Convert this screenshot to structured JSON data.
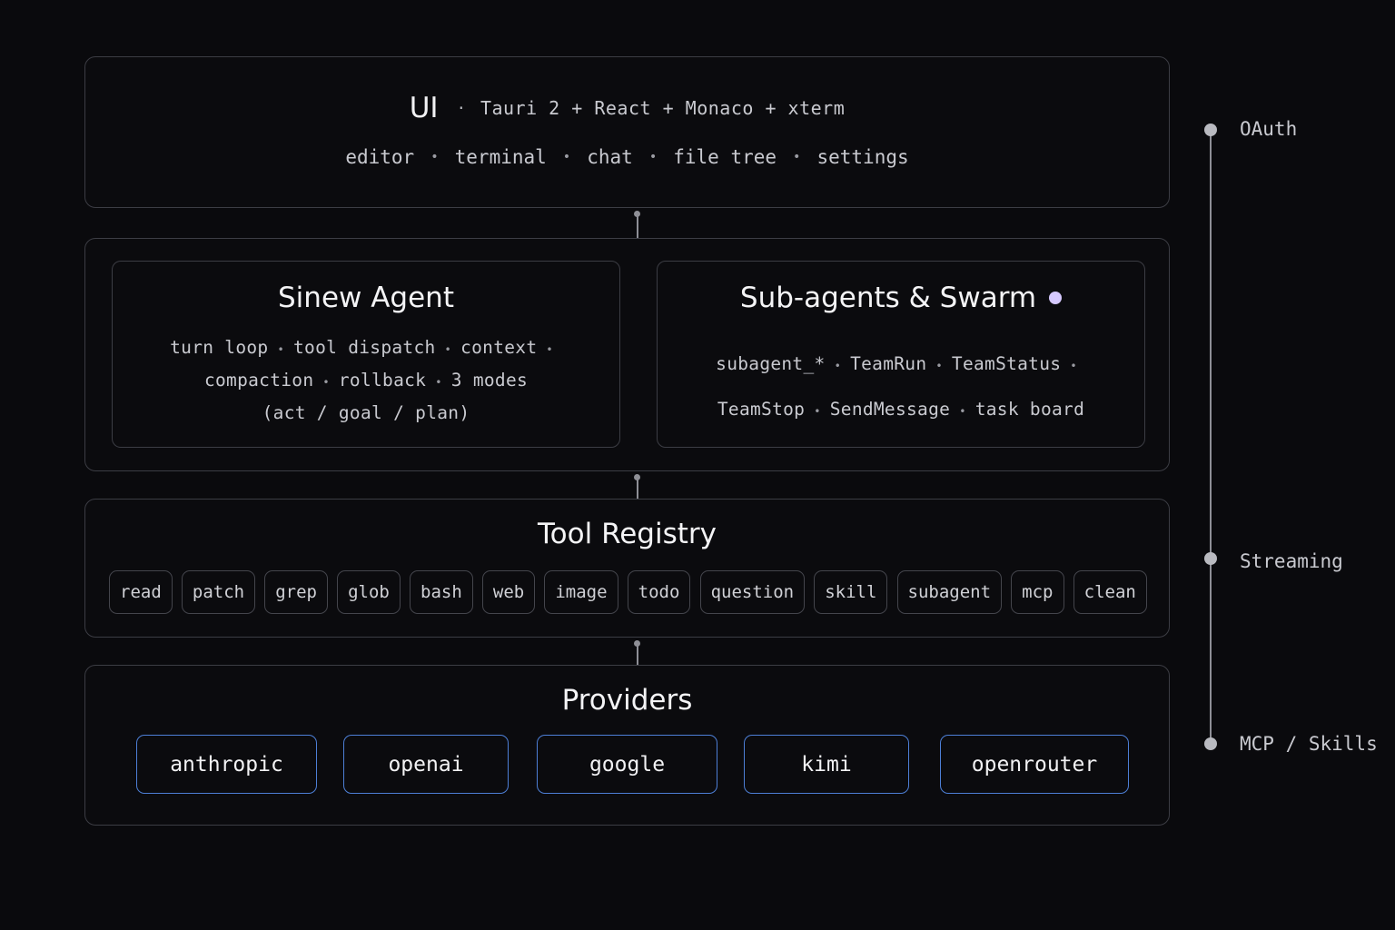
{
  "ui_layer": {
    "title": "UI",
    "separator": "·",
    "stack": "Tauri 2 + React + Monaco + xterm",
    "features": [
      "editor",
      "terminal",
      "chat",
      "file tree",
      "settings"
    ]
  },
  "agent_layer": {
    "sinew": {
      "title": "Sinew Agent",
      "line1": [
        "turn loop",
        "tool dispatch",
        "context"
      ],
      "line2": [
        "compaction",
        "rollback",
        "3 modes"
      ],
      "line3": "(act / goal / plan)"
    },
    "swarm": {
      "title": "Sub-agents & Swarm",
      "accent_color": "#d6c9ff",
      "line1": [
        "subagent_*",
        "TeamRun",
        "TeamStatus"
      ],
      "line2": [
        "TeamStop",
        "SendMessage",
        "task board"
      ]
    }
  },
  "tool_registry": {
    "title": "Tool Registry",
    "tools": [
      "read",
      "patch",
      "grep",
      "glob",
      "bash",
      "web",
      "image",
      "todo",
      "question",
      "skill",
      "subagent",
      "mcp",
      "clean"
    ]
  },
  "providers": {
    "title": "Providers",
    "accent_color": "#4d7fd6",
    "items": [
      "anthropic",
      "openai",
      "google",
      "kimi",
      "openrouter"
    ]
  },
  "rail": {
    "labels": [
      "OAuth",
      "Streaming",
      "MCP / Skills"
    ]
  }
}
